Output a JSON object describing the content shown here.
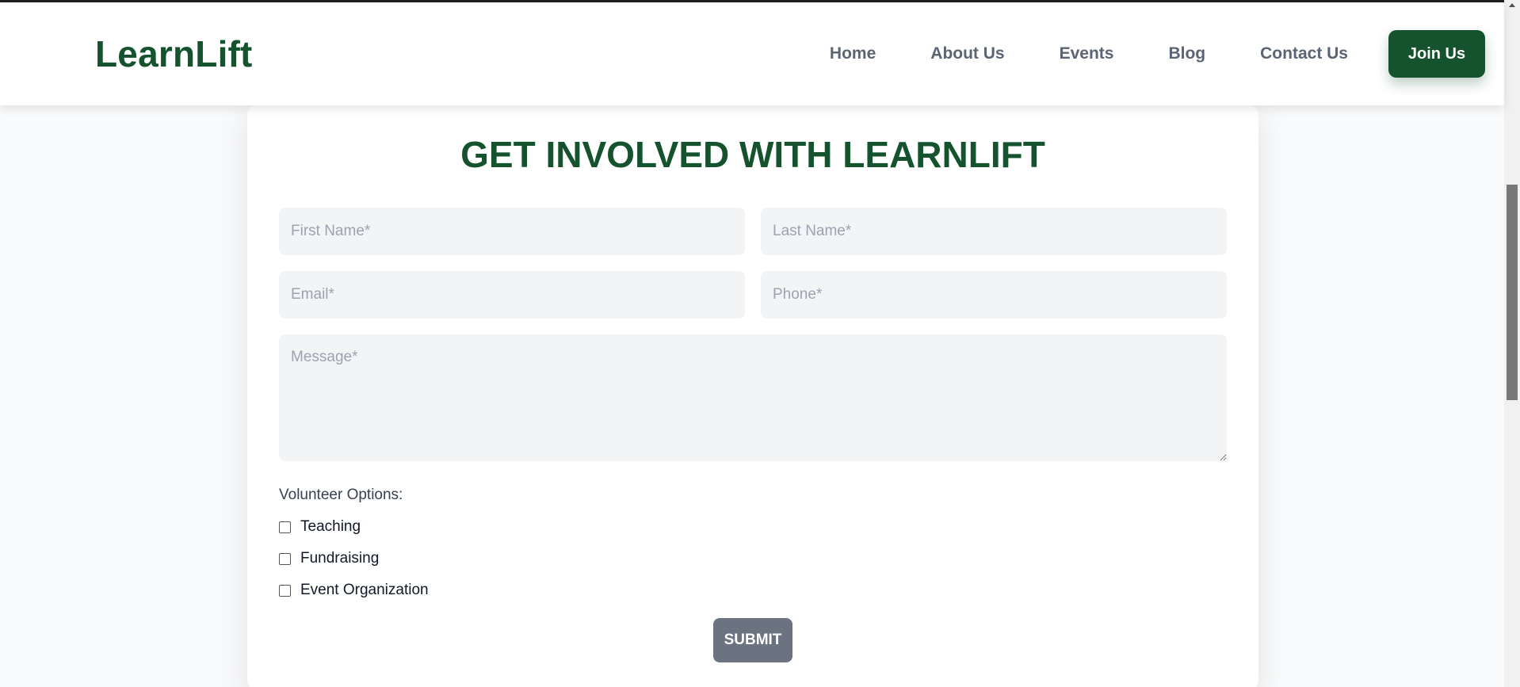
{
  "brand": {
    "name": "LearnLift",
    "color": "#14532d"
  },
  "nav": {
    "links": [
      "Home",
      "About Us",
      "Events",
      "Blog",
      "Contact Us"
    ],
    "cta": "Join Us"
  },
  "form": {
    "title": "GET INVOLVED WITH LEARNLIFT",
    "first_name_placeholder": "First Name*",
    "last_name_placeholder": "Last Name*",
    "email_placeholder": "Email*",
    "phone_placeholder": "Phone*",
    "message_placeholder": "Message*",
    "volunteer_label": "Volunteer Options:",
    "options": [
      "Teaching",
      "Fundraising",
      "Event Organization"
    ],
    "submit_label": "SUBMIT"
  },
  "colors": {
    "accent": "#14532d",
    "input_bg": "#f3f4f6",
    "submit_bg": "#6b7280",
    "nav_text": "#5b6472"
  }
}
